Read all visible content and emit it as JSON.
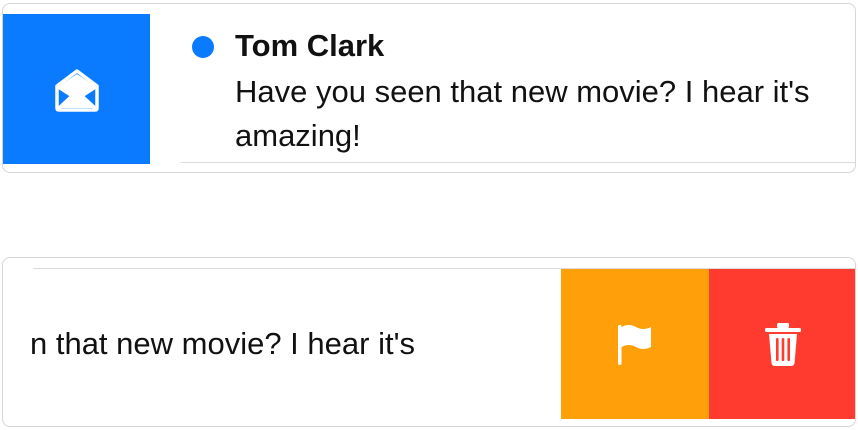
{
  "message": {
    "sender": "Tom Clark",
    "preview_line1": "Have you seen that new movie? I hear it's",
    "preview_line2": "amazing!",
    "unread": true
  },
  "swiped_row": {
    "preview_fragment": "n that new movie? I hear it's"
  },
  "actions": {
    "mark_read": {
      "icon": "envelope-open-icon",
      "color": "#0a7aff"
    },
    "flag": {
      "icon": "flag-icon",
      "color": "#ff9f0a"
    },
    "trash": {
      "icon": "trash-icon",
      "color": "#ff3b30"
    }
  },
  "colors": {
    "unread_dot": "#0a7aff"
  }
}
